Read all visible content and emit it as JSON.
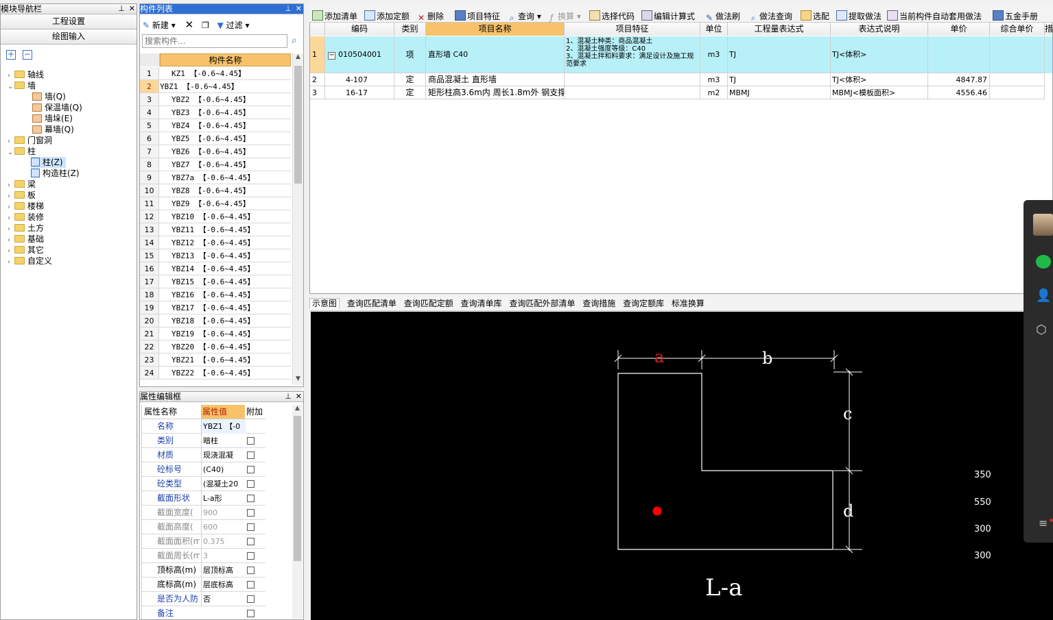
{
  "nav": {
    "title": "模块导航栏",
    "btn_project": "工程设置",
    "btn_drawing": "绘图输入",
    "tree": [
      "轴线",
      "墙",
      "墙(Q)",
      "保温墙(Q)",
      "墙垛(E)",
      "幕墙(Q)",
      "门窗洞",
      "柱",
      "柱(Z)",
      "构造柱(Z)",
      "梁",
      "板",
      "楼梯",
      "装修",
      "土方",
      "基础",
      "其它",
      "自定义"
    ]
  },
  "component_list": {
    "title": "构件列表",
    "new_label": "新建",
    "filter_label": "过滤",
    "search_placeholder": "搜索构件...",
    "col_header": "构件名称",
    "rows": [
      {
        "n": "1",
        "name": "KZ1 【-0.6~4.45】"
      },
      {
        "n": "2",
        "name": "YBZ1 【-0.6~4.45】"
      },
      {
        "n": "3",
        "name": "YBZ2 【-0.6~4.45】"
      },
      {
        "n": "4",
        "name": "YBZ3 【-0.6~4.45】"
      },
      {
        "n": "5",
        "name": "YBZ4 【-0.6~4.45】"
      },
      {
        "n": "6",
        "name": "YBZ5 【-0.6~4.45】"
      },
      {
        "n": "7",
        "name": "YBZ6 【-0.6~4.45】"
      },
      {
        "n": "8",
        "name": "YBZ7 【-0.6~4.45】"
      },
      {
        "n": "9",
        "name": "YBZ7a 【-0.6~4.45】"
      },
      {
        "n": "10",
        "name": "YBZ8 【-0.6~4.45】"
      },
      {
        "n": "11",
        "name": "YBZ9 【-0.6~4.45】"
      },
      {
        "n": "12",
        "name": "YBZ10 【-0.6~4.45】"
      },
      {
        "n": "13",
        "name": "YBZ11 【-0.6~4.45】"
      },
      {
        "n": "14",
        "name": "YBZ12 【-0.6~4.45】"
      },
      {
        "n": "15",
        "name": "YBZ13 【-0.6~4.45】"
      },
      {
        "n": "16",
        "name": "YBZ14 【-0.6~4.45】"
      },
      {
        "n": "17",
        "name": "YBZ15 【-0.6~4.45】"
      },
      {
        "n": "18",
        "name": "YBZ16 【-0.6~4.45】"
      },
      {
        "n": "19",
        "name": "YBZ17 【-0.6~4.45】"
      },
      {
        "n": "20",
        "name": "YBZ18 【-0.6~4.45】"
      },
      {
        "n": "21",
        "name": "YBZ19 【-0.6~4.45】"
      },
      {
        "n": "22",
        "name": "YBZ20 【-0.6~4.45】"
      },
      {
        "n": "23",
        "name": "YBZ21 【-0.6~4.45】"
      },
      {
        "n": "24",
        "name": "YBZ22 【-0.6~4.45】"
      }
    ]
  },
  "props": {
    "title": "属性编辑框",
    "h_name": "属性名称",
    "h_value": "属性值",
    "h_extra": "附加",
    "rows": [
      {
        "name": "名称",
        "value": "YBZ1 【-0"
      },
      {
        "name": "类别",
        "value": "暗柱"
      },
      {
        "name": "材质",
        "value": "现浇混凝"
      },
      {
        "name": "砼标号",
        "value": "(C40)"
      },
      {
        "name": "砼类型",
        "value": "(混凝土20"
      },
      {
        "name": "截面形状",
        "value": "L-a形"
      },
      {
        "name": "截面宽度(",
        "value": "900"
      },
      {
        "name": "截面高度(",
        "value": "600"
      },
      {
        "name": "截面面积(m",
        "value": "0.375"
      },
      {
        "name": "截面周长(m",
        "value": "3"
      },
      {
        "name": "顶标高(m)",
        "value": "层顶标高"
      },
      {
        "name": "底标高(m)",
        "value": "层底标高"
      },
      {
        "name": "是否为人防",
        "value": "否"
      },
      {
        "name": "备注",
        "value": ""
      }
    ]
  },
  "toolbar": [
    "添加清单",
    "添加定额",
    "删除",
    "项目特征",
    "查询",
    "换算",
    "选择代码",
    "编辑计算式",
    "做法刷",
    "做法查询",
    "选配",
    "提取做法",
    "当前构件自动套用做法",
    "五金手册"
  ],
  "table": {
    "headers": [
      "编码",
      "类别",
      "项目名称",
      "项目特征",
      "单位",
      "工程量表达式",
      "表达式说明",
      "单价",
      "综合单价",
      "措"
    ],
    "rows": [
      {
        "n": "1",
        "code": "010504001",
        "type": "项",
        "name": "直形墙 C40",
        "feature": "1、混凝土种类：商品混凝土\n2、混凝土强度等级：C40\n3、混凝土拌和料要求：满足设计及施工规范要求",
        "unit": "m3",
        "expr": "TJ",
        "desc": "TJ<体积>",
        "price": "",
        "total": ""
      },
      {
        "n": "2",
        "code": "4-107",
        "type": "定",
        "name": "商品混凝土 直形墙",
        "feature": "",
        "unit": "m3",
        "expr": "TJ",
        "desc": "TJ<体积>",
        "price": "4847.87",
        "total": ""
      },
      {
        "n": "3",
        "code": "16-17",
        "type": "定",
        "name": "矩形柱高3.6m内 周长1.8m外 钢支撑",
        "feature": "",
        "unit": "m2",
        "expr": "MBMJ",
        "desc": "MBMJ<模板面积>",
        "price": "4556.46",
        "total": ""
      }
    ]
  },
  "bottom_tabs": [
    "示意图",
    "查询匹配清单",
    "查询匹配定额",
    "查询清单库",
    "查询匹配外部清单",
    "查询措施",
    "查询定额库",
    "标准换算"
  ],
  "diagram": {
    "labels": {
      "a": "a",
      "b": "b",
      "c": "c",
      "d": "d"
    },
    "shape_name": "L-a",
    "dims": [
      "350",
      "550",
      "300",
      "300"
    ]
  },
  "colors": {
    "accent": "#2e6fd3",
    "header_hl": "#f7c26a",
    "row_hl": "#b8f0f8"
  }
}
